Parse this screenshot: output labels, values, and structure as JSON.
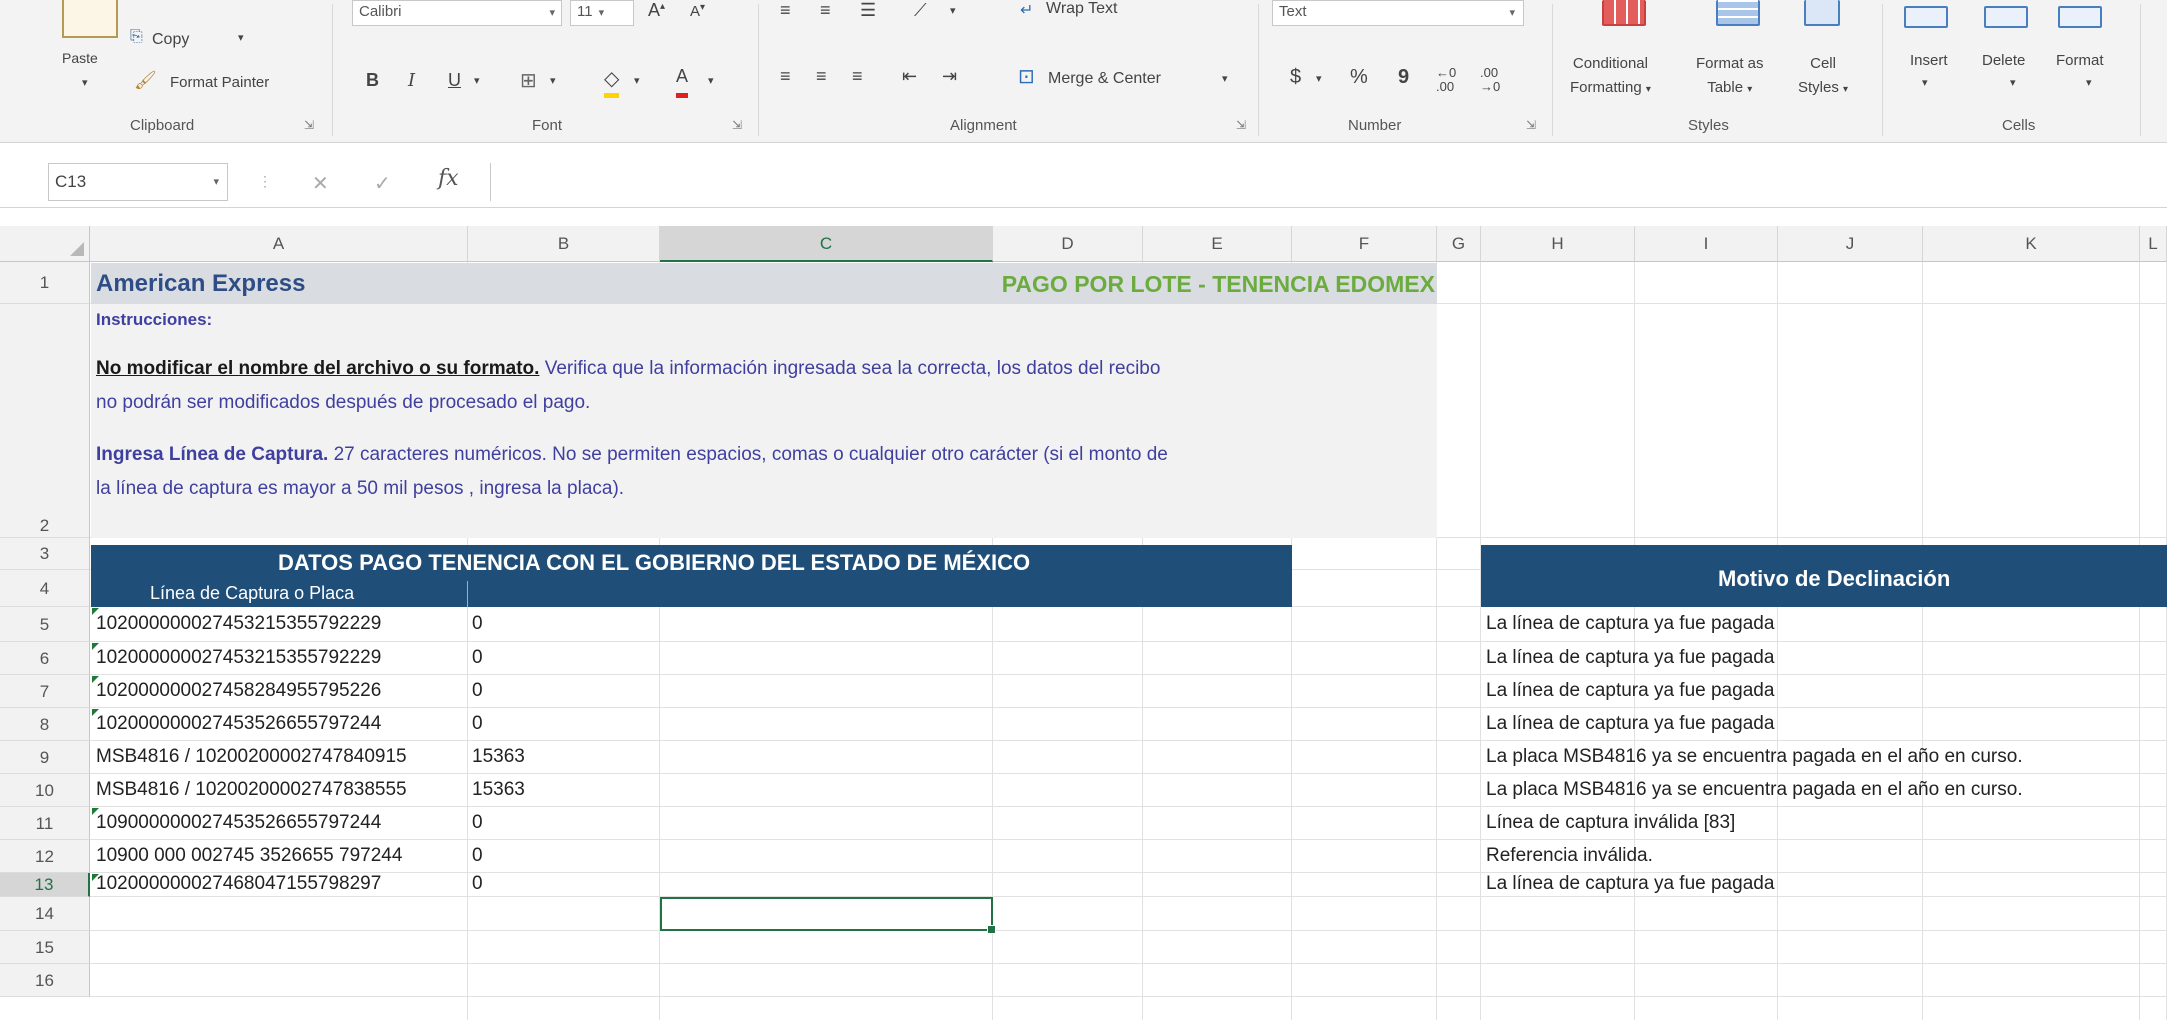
{
  "ribbon": {
    "clipboard": {
      "paste": "Paste",
      "copy": "Copy",
      "format_painter": "Format Painter",
      "label": "Clipboard"
    },
    "font": {
      "name": "Calibri",
      "size": "11",
      "bold": "B",
      "italic": "I",
      "underline": "U",
      "font_color": "A",
      "label": "Font"
    },
    "alignment": {
      "wrap_text": "Wrap Text",
      "merge_center": "Merge & Center",
      "label": "Alignment"
    },
    "number": {
      "format": "Text",
      "currency": "$",
      "percent": "%",
      "comma": "9",
      "label": "Number"
    },
    "styles": {
      "conditional_formatting": [
        "Conditional",
        "Formatting"
      ],
      "format_as_table": [
        "Format as",
        "Table"
      ],
      "cell_styles": [
        "Cell",
        "Styles"
      ],
      "label": "Styles"
    },
    "cells": {
      "insert": "Insert",
      "delete": "Delete",
      "format": "Format",
      "label": "Cells"
    }
  },
  "formula_bar": {
    "name_box": "C13",
    "fx": "fx",
    "value": ""
  },
  "columns": [
    "A",
    "B",
    "C",
    "D",
    "E",
    "F",
    "G",
    "H",
    "I",
    "J",
    "K",
    "L"
  ],
  "rows": [
    "1",
    "2",
    "3",
    "4",
    "5",
    "6",
    "7",
    "8",
    "9",
    "10",
    "11",
    "12",
    "13",
    "14",
    "15",
    "16"
  ],
  "sheet": {
    "title": "American Express",
    "subtitle": "PAGO POR LOTE - TENENCIA EDOMEX",
    "instructions_label": "Instrucciones:",
    "instr1_bold": "No modificar el nombre del archivo o su formato.",
    "instr1_rest": " Verifica que la información ingresada sea la correcta, los datos del recibo",
    "instr1_line2": "no podrán ser modificados después de procesado el pago.",
    "instr2_bold": "Ingresa Línea de Captura.",
    "instr2_rest": "  27 caracteres numéricos. No se permiten espacios, comas o cualquier otro carácter (si el monto de",
    "instr2_line2": "la línea de captura es mayor a 50 mil pesos , ingresa la placa).",
    "header_main": "DATOS PAGO TENENCIA CON EL GOBIERNO DEL ESTADO DE MÉXICO",
    "header_sub": "Línea de Captura o Placa",
    "decline_header": "Motivo de Declinación",
    "data_rows": [
      {
        "a": "10200000002745321535579222​9",
        "b": "0",
        "reason": "La línea de captura ya fue pagada"
      },
      {
        "a": "102000000027453215355792229",
        "b": "0",
        "reason": "La línea de captura ya fue pagada"
      },
      {
        "a": "102000000027458284955795226",
        "b": "0",
        "reason": "La línea de captura ya fue pagada"
      },
      {
        "a": "102000000027453526655797244",
        "b": "0",
        "reason": "La línea de captura ya fue pagada"
      },
      {
        "a": "MSB4816 / 10200200002747840915",
        "b": "15363",
        "reason": "La placa MSB4816 ya se encuentra pagada en el año en curso."
      },
      {
        "a": "MSB4816 / 10200200002747838555",
        "b": "15363",
        "reason": "La placa MSB4816 ya se encuentra pagada en el año en curso."
      },
      {
        "a": "109000000027453526655797244",
        "b": "0",
        "reason": "Línea de captura inválida [83]"
      },
      {
        "a": "10900 000 002745 3526655 797244",
        "b": "0",
        "reason": "Referencia inválida."
      },
      {
        "a": "102000000027468047155798297",
        "b": "0",
        "reason": "La línea de captura ya fue pagada"
      }
    ]
  },
  "colors": {
    "title_blue": "#2e4d86",
    "subtitle_green": "#6cab3d",
    "navy": "#1f4e79",
    "purple_text": "#3f3fa0",
    "excel_green": "#217346"
  }
}
